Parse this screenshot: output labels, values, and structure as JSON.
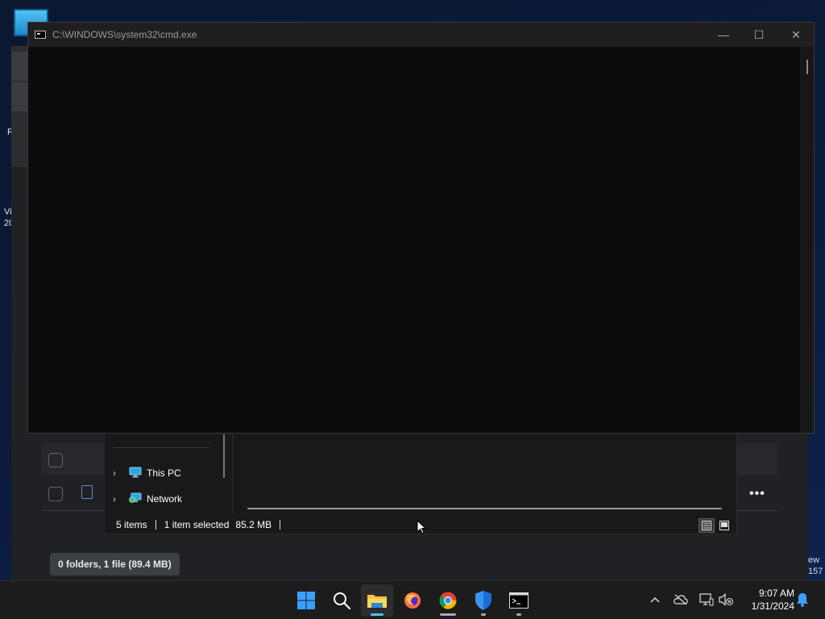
{
  "desktop": {
    "left_fragments": [
      "R",
      "Vi",
      "20"
    ],
    "right_fragments": [
      "ew",
      "157"
    ]
  },
  "cmd": {
    "title": "C:\\WINDOWS\\system32\\cmd.exe",
    "minimize_glyph": "—",
    "maximize_glyph": "☐",
    "close_glyph": "✕"
  },
  "explorer": {
    "nav_items": [
      {
        "label": "This PC",
        "icon": "this-pc-icon"
      },
      {
        "label": "Network",
        "icon": "network-icon"
      }
    ],
    "status": {
      "items": "5 items",
      "selected": "1 item selected",
      "size": "85.2 MB"
    }
  },
  "browser": {
    "summary": "0 folders, 1 file (89.4 MB)",
    "more_glyph": "•••"
  },
  "taskbar": {
    "apps": [
      "start-icon",
      "search-icon",
      "file-explorer-icon",
      "firefox-icon",
      "chrome-icon",
      "defender-icon",
      "terminal-icon"
    ],
    "tray": [
      "show-hidden-icons-chevron",
      "onedrive-icon",
      "network-icon",
      "volume-muted-icon"
    ],
    "time": "9:07 AM",
    "date": "1/31/2024"
  },
  "colors": {
    "accent_blue": "#0078d4",
    "cmd_background": "#0c0c0c",
    "taskbar": "#1c1c1c"
  }
}
